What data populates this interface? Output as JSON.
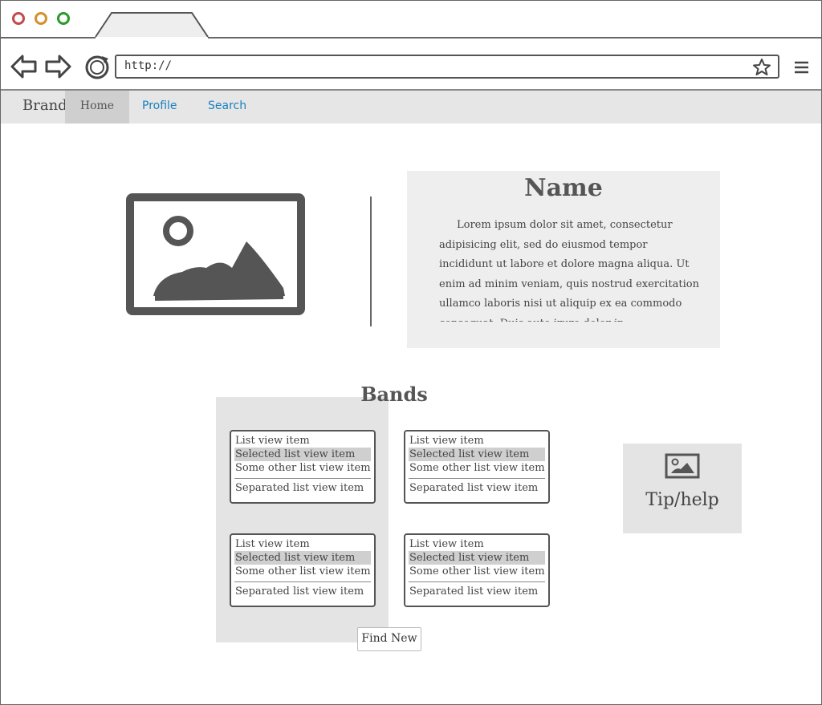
{
  "browser": {
    "url": "http://",
    "traffic_lights": [
      "#c34a4a",
      "#d6902a",
      "#2a9a2a"
    ]
  },
  "navbar": {
    "brand": "Brand",
    "items": [
      {
        "label": "Home",
        "active": true
      },
      {
        "label": "Profile",
        "active": false
      },
      {
        "label": "Search",
        "active": false
      }
    ],
    "link_color": "#1a80c0"
  },
  "profile": {
    "name": "Name",
    "bio": "Lorem ipsum dolor sit amet, consectetur adipisicing elit, sed do eiusmod tempor incididunt ut labore et dolore magna aliqua. Ut enim ad minim veniam, quis nostrud exercitation ullamco laboris nisi ut aliquip ex ea commodo consequat. Duis aute irure dolor in reprehenderit in voluptate velit esse cillum"
  },
  "bands": {
    "title": "Bands",
    "lists": [
      {
        "items": [
          "List view item",
          "Selected list view item",
          "Some other list view item"
        ],
        "separated_item": "Separated list view item",
        "selected_index": 1
      },
      {
        "items": [
          "List view item",
          "Selected list view item",
          "Some other list view item"
        ],
        "separated_item": "Separated list view item",
        "selected_index": 1
      },
      {
        "items": [
          "List view item",
          "Selected list view item",
          "Some other list view item"
        ],
        "separated_item": "Separated list view item",
        "selected_index": 1
      },
      {
        "items": [
          "List view item",
          "Selected list view item",
          "Some other list view item"
        ],
        "separated_item": "Separated list view item",
        "selected_index": 1
      }
    ],
    "find_new_label": "Find New"
  },
  "tip": {
    "label": "Tip/help"
  }
}
